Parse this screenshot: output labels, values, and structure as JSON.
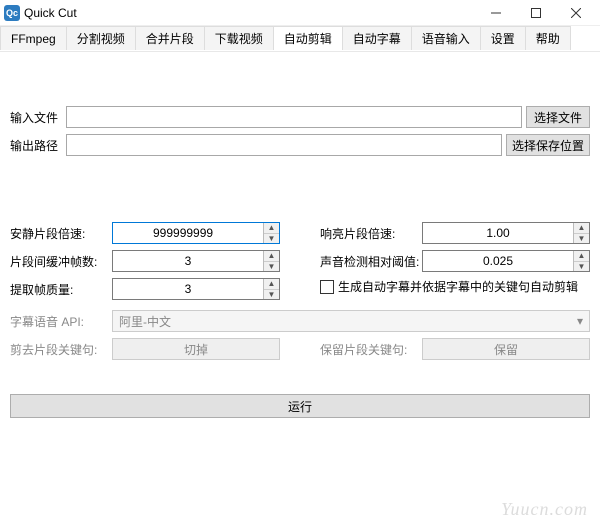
{
  "window": {
    "icon_label": "Qc",
    "title": "Quick Cut"
  },
  "tabs": {
    "items": [
      "FFmpeg",
      "分割视频",
      "合并片段",
      "下载视频",
      "自动剪辑",
      "自动字幕",
      "语音输入",
      "设置",
      "帮助"
    ],
    "active_index": 4
  },
  "file_section": {
    "input_label": "输入文件",
    "input_value": "",
    "input_button": "选择文件",
    "output_label": "输出路径",
    "output_value": "",
    "output_button": "选择保存位置"
  },
  "params_left": {
    "quiet_speed_label": "安静片段倍速:",
    "quiet_speed_value": "999999999",
    "buffer_frames_label": "片段间缓冲帧数:",
    "buffer_frames_value": "3",
    "extract_quality_label": "提取帧质量:",
    "extract_quality_value": "3"
  },
  "params_right": {
    "loud_speed_label": "响亮片段倍速:",
    "loud_speed_value": "1.00",
    "threshold_label": "声音检测相对阈值:",
    "threshold_value": "0.025",
    "checkbox_label": "生成自动字幕并依据字幕中的关键句自动剪辑",
    "checkbox_checked": false
  },
  "disabled_section": {
    "api_label": "字幕语音 API:",
    "api_value": "阿里-中文",
    "cut_keyword_label": "剪去片段关键句:",
    "cut_button": "切掉",
    "keep_keyword_label": "保留片段关键句:",
    "keep_button": "保留"
  },
  "run_button": "运行",
  "watermark": "Yuucn.com"
}
